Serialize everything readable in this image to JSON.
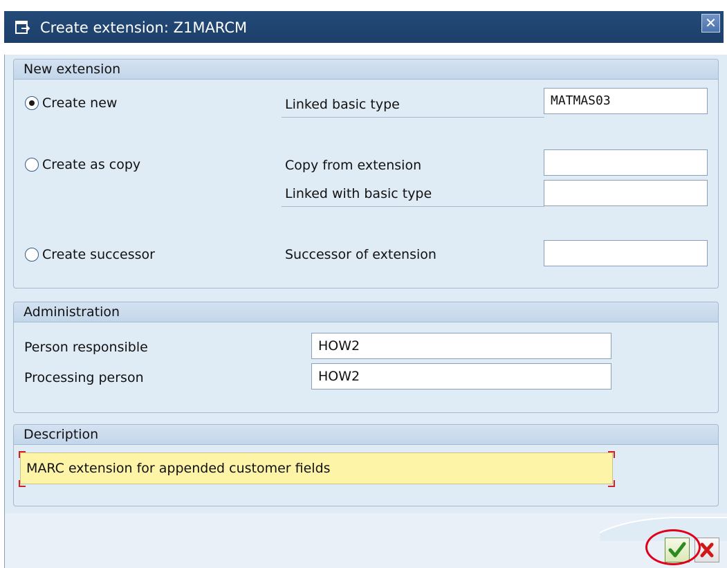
{
  "window": {
    "title": "Create extension: Z1MARCM",
    "close_label": "✕"
  },
  "new_extension": {
    "header": "New extension",
    "create_new": {
      "label": "Create new",
      "selected": true
    },
    "create_as_copy": {
      "label": "Create as copy",
      "selected": false
    },
    "create_successor": {
      "label": "Create successor",
      "selected": false
    },
    "linked_basic_type": {
      "label": "Linked basic type",
      "value": "MATMAS03"
    },
    "copy_from_extension": {
      "label": "Copy from extension",
      "value": ""
    },
    "linked_with_basic_type": {
      "label": "Linked with basic type",
      "value": ""
    },
    "successor_of_extension": {
      "label": "Successor of extension",
      "value": ""
    }
  },
  "administration": {
    "header": "Administration",
    "person_responsible": {
      "label": "Person responsible",
      "value": "HOW2"
    },
    "processing_person": {
      "label": "Processing person",
      "value": "HOW2"
    }
  },
  "description": {
    "header": "Description",
    "value": "MARC extension for appended customer fields"
  },
  "buttons": {
    "ok_icon": "checkmark-icon",
    "cancel_icon": "cancel-x-icon"
  },
  "colors": {
    "title_bar": "#1d3f6a",
    "window_bg": "#dfebf5",
    "required_field": "#fdf4a8",
    "highlight_circle": "#e0001a"
  }
}
